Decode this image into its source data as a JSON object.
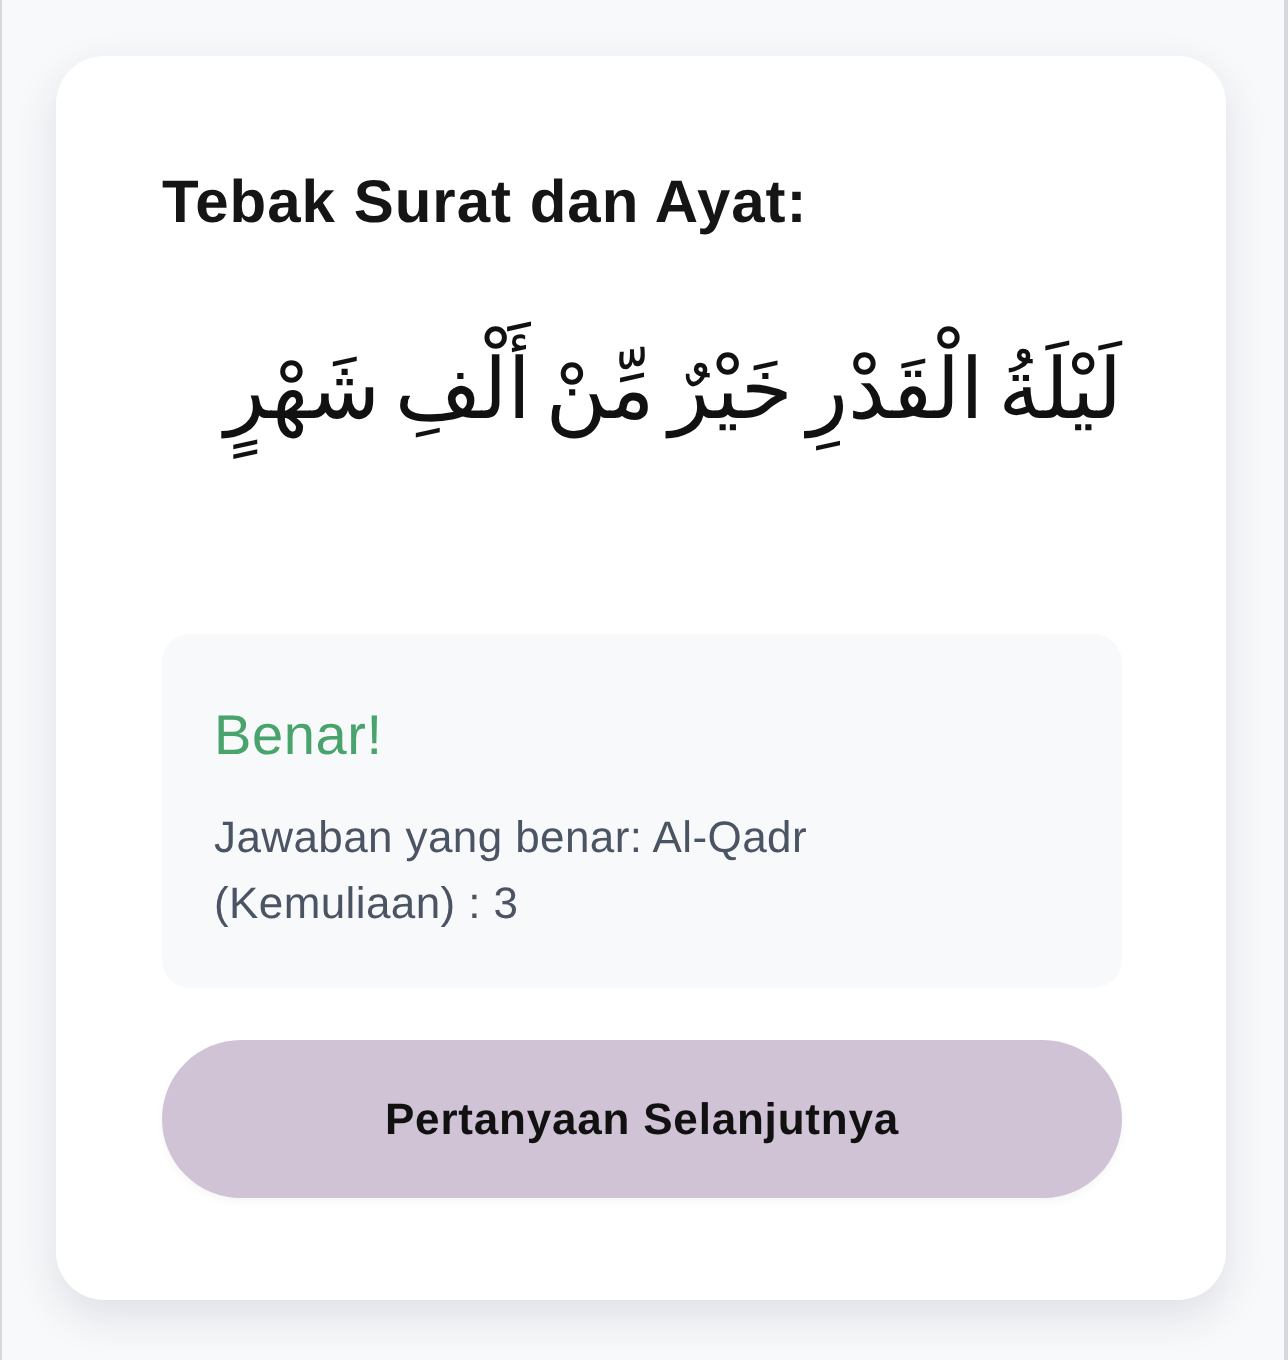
{
  "quiz": {
    "title": "Tebak Surat dan Ayat:",
    "verse": "لَيْلَةُ الْقَدْرِ خَيْرٌ مِّنْ أَلْفِ شَهْرٍ"
  },
  "feedback": {
    "correct": true,
    "heading": "Benar!",
    "message": "Jawaban yang benar: Al-Qadr (Kemuliaan) : 3"
  },
  "next_button": {
    "label": "Pertanyaan Selanjutnya"
  }
}
